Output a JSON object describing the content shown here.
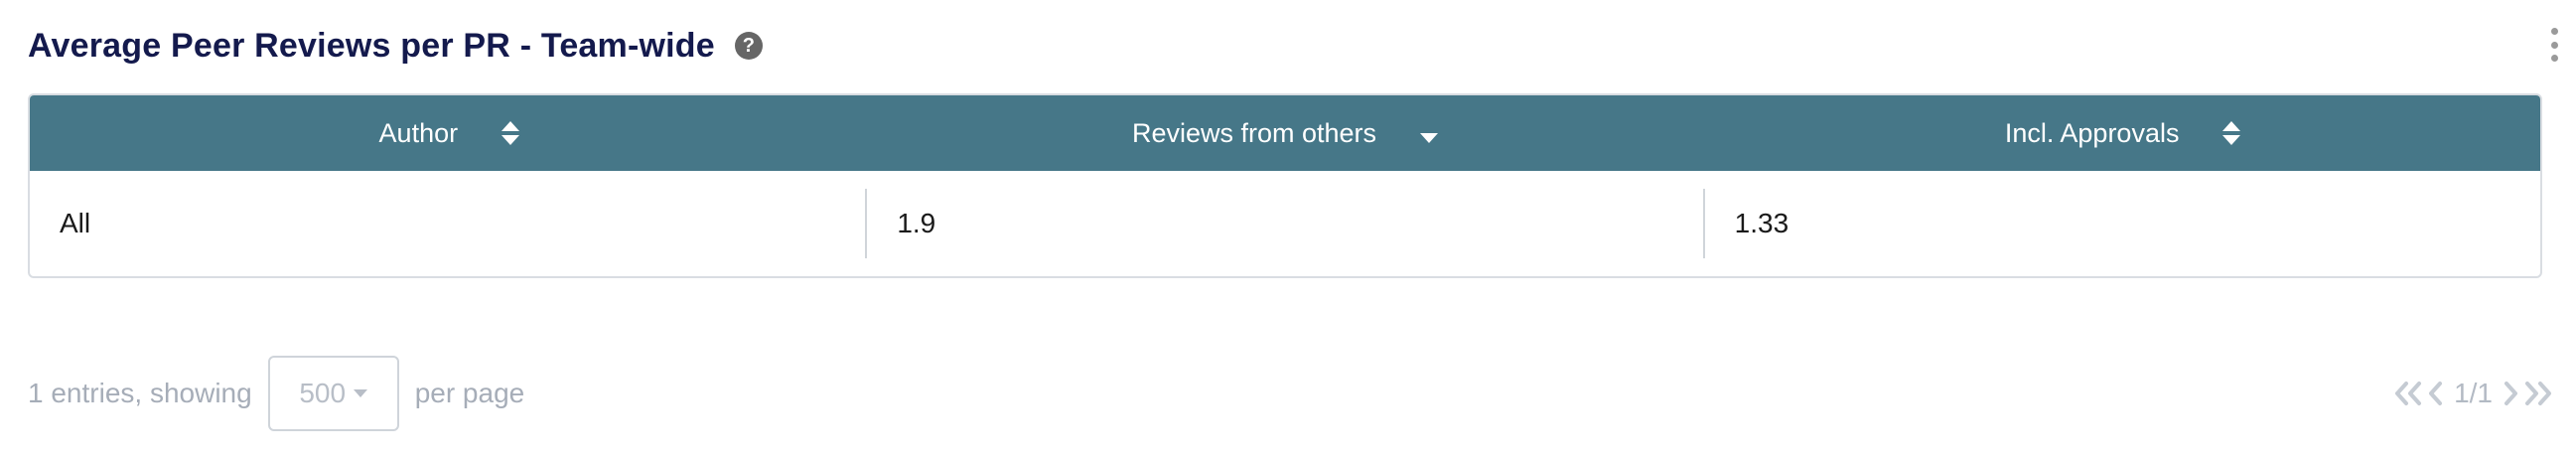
{
  "widget": {
    "title": "Average Peer Reviews per PR - Team-wide",
    "help_icon": "?",
    "menu_icon": "kebab-menu-icon"
  },
  "table": {
    "columns": [
      {
        "label": "Author",
        "sort": "unsorted"
      },
      {
        "label": "Reviews from others",
        "sort": "descending"
      },
      {
        "label": "Incl. Approvals",
        "sort": "unsorted"
      }
    ],
    "rows": [
      [
        "All",
        "1.9",
        "1.33"
      ]
    ],
    "header_color": "#467788"
  },
  "footer": {
    "entries_text": "1 entries, showing",
    "per_page_value": "500",
    "per_page_suffix": "per page",
    "pagination": "1/1"
  }
}
